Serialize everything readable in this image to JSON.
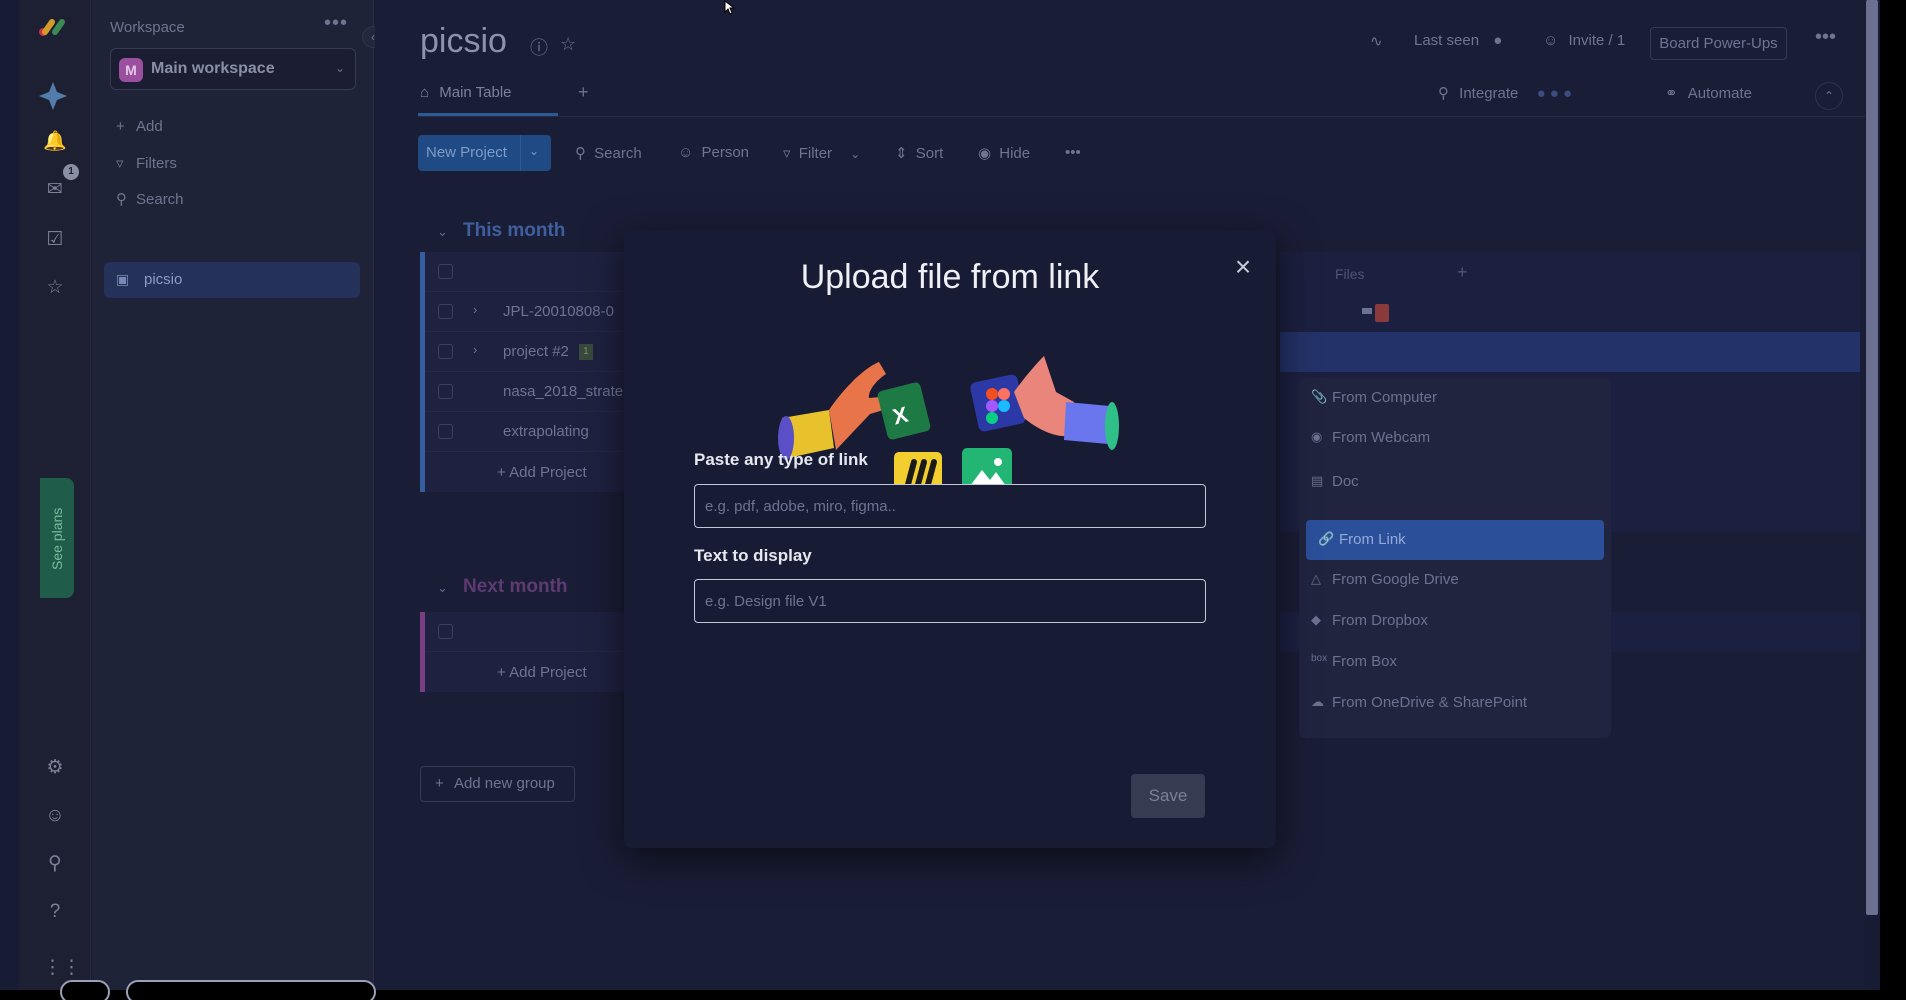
{
  "sidebar": {
    "workspace_label": "Workspace",
    "workspace_avatar": "M",
    "workspace_name": "Main workspace",
    "add_label": "Add",
    "filters_label": "Filters",
    "search_label": "Search",
    "board_name": "picsio"
  },
  "rail": {
    "inbox_badge": "1",
    "see_plans": "See plans"
  },
  "header": {
    "board_title": "picsio",
    "last_seen": "Last seen",
    "invite": "Invite / 1",
    "power_ups": "Board Power-Ups",
    "tab_main": "Main Table",
    "integrate": "Integrate",
    "automate": "Automate"
  },
  "toolbar": {
    "new_project": "New Project",
    "search": "Search",
    "person": "Person",
    "filter": "Filter",
    "sort": "Sort",
    "hide": "Hide"
  },
  "groups": {
    "this_month": "This month",
    "next_month": "Next month",
    "add_project": "+ Add Project",
    "add_new_group": "Add new group"
  },
  "rows": [
    {
      "name": "JPL-20010808-0",
      "expandable": true,
      "tag": ""
    },
    {
      "name": "project #2",
      "expandable": true,
      "tag": "1"
    },
    {
      "name": "nasa_2018_strate",
      "expandable": false,
      "tag": ""
    },
    {
      "name": "extrapolating",
      "expandable": false,
      "tag": ""
    }
  ],
  "files_column": "Files",
  "upload_menu": {
    "from_computer": "From Computer",
    "from_webcam": "From Webcam",
    "doc": "Doc",
    "from_link": "From Link",
    "from_google_drive": "From Google Drive",
    "from_dropbox": "From Dropbox",
    "from_box": "From Box",
    "from_onedrive": "From OneDrive & SharePoint"
  },
  "modal": {
    "title": "Upload file from link",
    "link_label": "Paste any type of link",
    "link_placeholder": "e.g. pdf, adobe, miro, figma..",
    "link_value": "",
    "display_label": "Text to display",
    "display_placeholder": "e.g. Design file V1",
    "display_value": "",
    "save": "Save"
  },
  "colors": {
    "accent": "#2c4f9a",
    "modal_bg": "#181b34",
    "group_this_month": "#365d9e",
    "group_next_month": "#7a3e86"
  }
}
